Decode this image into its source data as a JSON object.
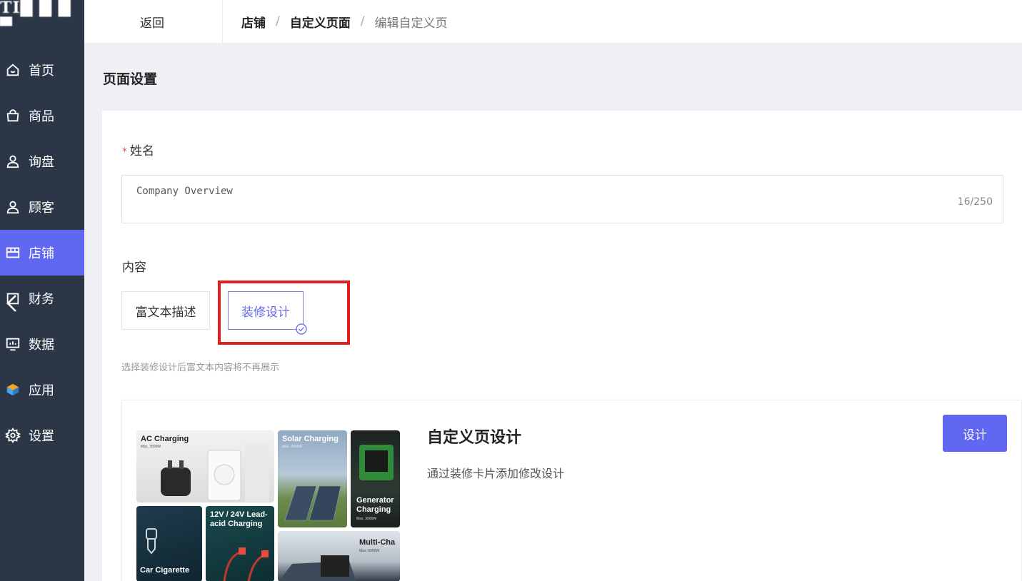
{
  "logo": {
    "text": "TI█ █ █ ▀"
  },
  "sidebar": {
    "items": [
      {
        "label": "首页",
        "icon": "home-icon"
      },
      {
        "label": "商品",
        "icon": "shopping-bag-icon"
      },
      {
        "label": "询盘",
        "icon": "user-icon"
      },
      {
        "label": "顾客",
        "icon": "user-icon"
      },
      {
        "label": "店铺",
        "icon": "store-icon",
        "active": true
      },
      {
        "label": "财务",
        "icon": "wallet-icon"
      },
      {
        "label": "数据",
        "icon": "monitor-chart-icon"
      },
      {
        "label": "应用",
        "icon": "cube-icon"
      },
      {
        "label": "设置",
        "icon": "gear-icon"
      }
    ]
  },
  "topbar": {
    "back_label": "返回",
    "breadcrumb": [
      "店铺",
      "自定义页面",
      "编辑自定义页"
    ]
  },
  "page": {
    "title": "页面设置",
    "name_label": "姓名",
    "name_value": "Company Overview",
    "name_count": "16/250",
    "content_label": "内容",
    "option_rich": "富文本描述",
    "option_deco": "装修设计",
    "hint": "选择装修设计后富文本内容将不再展示"
  },
  "design_card": {
    "title": "自定义页设计",
    "desc": "通过装修卡片添加修改设计",
    "button": "设计",
    "tiles": [
      {
        "title": "AC Charging",
        "sub": "Max. 3000W"
      },
      {
        "title": "Solar Charging",
        "sub": "Max. 2000W"
      },
      {
        "title": "Generator Charging",
        "sub": "Max. 3000W"
      },
      {
        "title": "Car Cigarette",
        "sub": ""
      },
      {
        "title": "12V / 24V Lead-acid Charging",
        "sub": ""
      },
      {
        "title": "Multi-Cha",
        "sub": "Max. 6000W"
      }
    ]
  },
  "colors": {
    "sidebar_bg": "#2b3647",
    "accent": "#6067f0",
    "highlight_box": "#e02020",
    "required_star": "#e84d4d"
  }
}
